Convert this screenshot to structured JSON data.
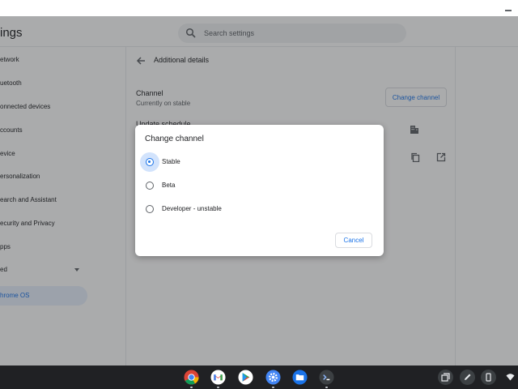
{
  "window": {
    "minimize_label": "minimize"
  },
  "header": {
    "title": "Settings",
    "title_visible": "ings",
    "search_placeholder": "Search settings"
  },
  "sidebar": {
    "items": [
      {
        "label": "Network",
        "visible": "etwork"
      },
      {
        "label": "Bluetooth",
        "visible": "uetooth"
      },
      {
        "label": "Connected devices",
        "visible": "onnected devices"
      },
      {
        "label": "Accounts",
        "visible": "ccounts"
      },
      {
        "label": "Device",
        "visible": "evice"
      },
      {
        "label": "Personalization",
        "visible": "ersonalization"
      },
      {
        "label": "Search and Assistant",
        "visible": "earch and Assistant"
      },
      {
        "label": "Security and Privacy",
        "visible": "ecurity and Privacy"
      },
      {
        "label": "Apps",
        "visible": "pps"
      },
      {
        "label": "Advanced",
        "visible": "ed"
      },
      {
        "label": "About Chrome OS",
        "visible": "hrome OS"
      }
    ]
  },
  "content": {
    "subpage_title": "Additional details",
    "channel": {
      "label": "Channel",
      "value": "Currently on stable",
      "button": "Change channel"
    },
    "update_schedule_label": "Update schedule"
  },
  "dialog": {
    "title": "Change channel",
    "options": [
      {
        "label": "Stable",
        "selected": true
      },
      {
        "label": "Beta",
        "selected": false
      },
      {
        "label": "Developer - unstable",
        "selected": false
      }
    ],
    "cancel": "Cancel"
  },
  "shelf": {
    "apps": [
      "chrome-icon",
      "gmail-icon",
      "play-store-icon",
      "settings-icon",
      "files-icon",
      "terminal-icon"
    ],
    "tray": [
      "overview-icon",
      "stylus-icon",
      "phone-hub-icon",
      "wifi-icon"
    ]
  },
  "colors": {
    "accent": "#1a73e8",
    "shelf": "#202124",
    "selected_bg": "#e8f0fe"
  }
}
